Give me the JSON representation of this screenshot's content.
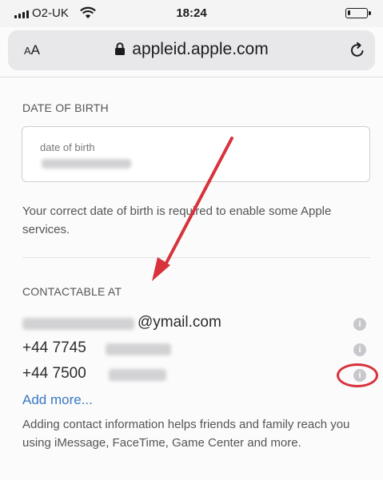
{
  "status_bar": {
    "carrier": "O2-UK",
    "time": "18:24",
    "battery_level": 0.12
  },
  "browser": {
    "text_size_button": "AA",
    "url": "appleid.apple.com"
  },
  "date_of_birth": {
    "heading": "DATE OF BIRTH",
    "field_label": "date of birth",
    "help_text": "Your correct date of birth is required to enable some Apple services."
  },
  "contactable_at": {
    "heading": "CONTACTABLE AT",
    "items": [
      {
        "visible_text": "@ymail.com"
      },
      {
        "visible_text": "+44 7745"
      },
      {
        "visible_text": "+44 7500"
      }
    ],
    "add_more": "Add more...",
    "help_text": "Adding contact information helps friends and family reach you using iMessage, FaceTime, Game Center and more."
  },
  "colors": {
    "annotation_red": "#d8323c",
    "link_blue": "#3a78c2",
    "info_icon_gray": "#c7c7cc"
  }
}
